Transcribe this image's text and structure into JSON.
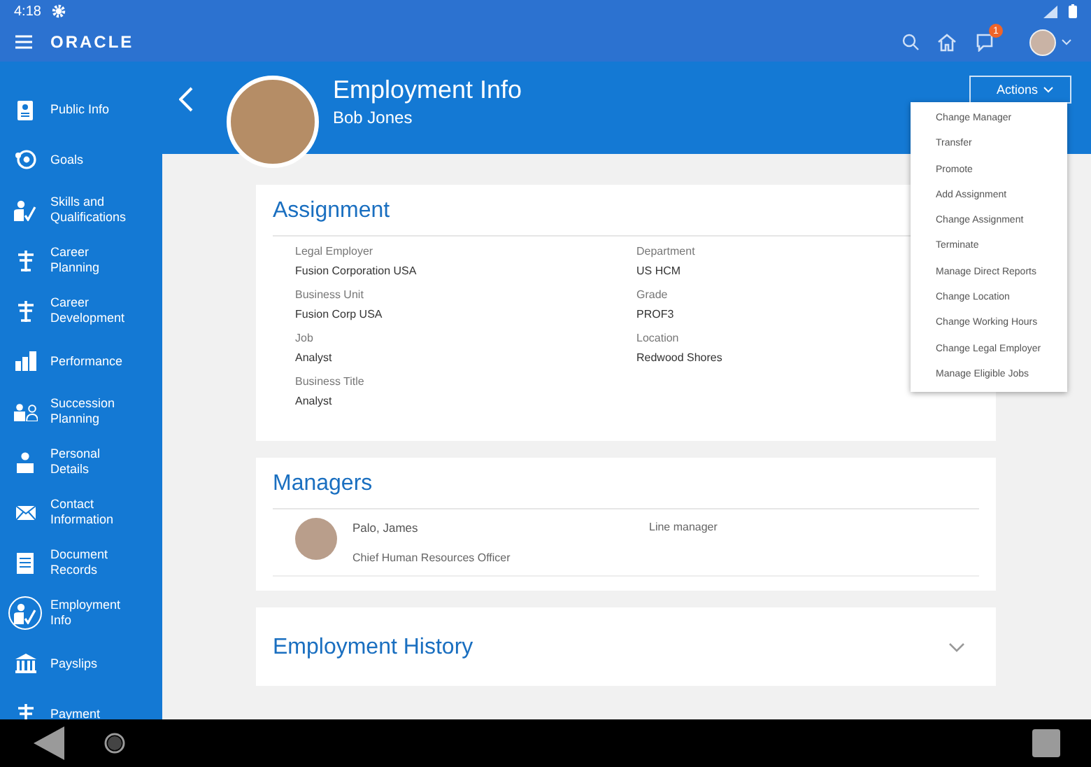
{
  "status_bar": {
    "time": "4:18"
  },
  "app_bar": {
    "logo": "ORACLE",
    "notification_count": "1"
  },
  "sidebar": {
    "items": [
      {
        "label": "Public Info",
        "kind": "badge",
        "selected": false
      },
      {
        "label": "Goals",
        "kind": "target",
        "selected": false
      },
      {
        "label": "Skills and Qualifications",
        "kind": "skills",
        "selected": false
      },
      {
        "label": "Career Planning",
        "kind": "signpost",
        "selected": false
      },
      {
        "label": "Career Development",
        "kind": "signpost",
        "selected": false
      },
      {
        "label": "Performance",
        "kind": "chart",
        "selected": false
      },
      {
        "label": "Succession Planning",
        "kind": "people",
        "selected": false
      },
      {
        "label": "Personal Details",
        "kind": "person",
        "selected": false
      },
      {
        "label": "Contact Information",
        "kind": "mail",
        "selected": false
      },
      {
        "label": "Document Records",
        "kind": "doc",
        "selected": false
      },
      {
        "label": "Employment Info",
        "kind": "skills",
        "selected": true
      },
      {
        "label": "Payslips",
        "kind": "bank",
        "selected": false
      },
      {
        "label": "Payment",
        "kind": "signpost",
        "selected": false
      }
    ]
  },
  "header": {
    "title": "Employment Info",
    "subtitle": "Bob Jones",
    "actions_button": "Actions"
  },
  "actions_menu": [
    "Change Manager",
    "Transfer",
    "Promote",
    "Add Assignment",
    "Change Assignment",
    "Terminate",
    "Manage Direct Reports",
    "Change Location",
    "Change Working Hours",
    "Change Legal Employer",
    "Manage Eligible Jobs"
  ],
  "assignment": {
    "title": "Assignment",
    "fields": [
      {
        "label": "Legal Employer",
        "value": "Fusion Corporation USA"
      },
      {
        "label": "Department",
        "value": "US HCM"
      },
      {
        "label": "Business Unit",
        "value": "Fusion Corp USA"
      },
      {
        "label": "Grade",
        "value": "PROF3"
      },
      {
        "label": "Job",
        "value": "Analyst"
      },
      {
        "label": "Location",
        "value": "Redwood Shores"
      },
      {
        "label": "Business Title",
        "value": "Analyst"
      }
    ]
  },
  "managers": {
    "title": "Managers",
    "rows": [
      {
        "name": "Palo, James",
        "job": "Chief Human Resources Officer",
        "relation": "Line manager"
      }
    ]
  },
  "employment_history": {
    "title": "Employment History",
    "expanded": false
  }
}
